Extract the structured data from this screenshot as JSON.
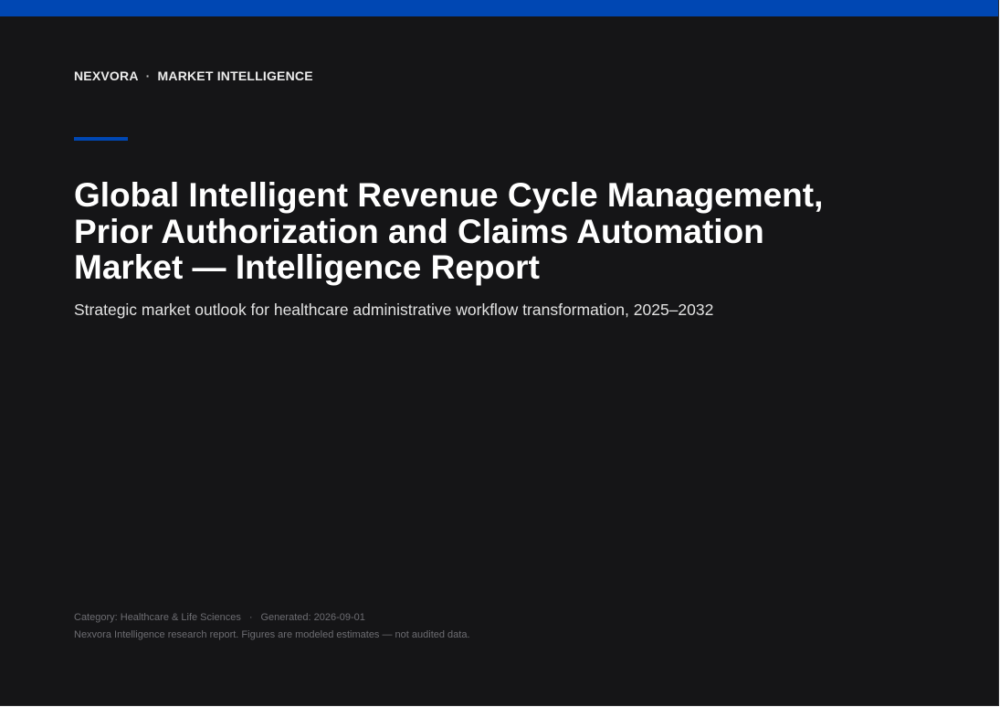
{
  "brand": {
    "name": "NEXVORA",
    "separator": "·",
    "section": "MARKET INTELLIGENCE"
  },
  "colors": {
    "accent": "#0047b3",
    "background": "#151517",
    "title_text": "#ffffff",
    "meta_text": "#6d6d72"
  },
  "report": {
    "title_lines": [
      "Global Intelligent Revenue Cycle Management,",
      "Prior Authorization and Claims Automation",
      "Market — Intelligence Report"
    ],
    "subtitle": "Strategic market outlook for healthcare administrative workflow transformation, 2025–2032"
  },
  "footer": {
    "category": "Category: Healthcare & Life Sciences",
    "separator": "·",
    "generated": "Generated: 2026-09-01",
    "disclaimer": "Nexvora Intelligence research report. Figures are modeled estimates — not audited data."
  }
}
